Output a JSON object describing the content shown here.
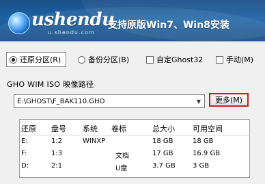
{
  "banner": {
    "logo_text": "ushendu",
    "logo_sub": "u.shendu.com",
    "slogan": "支持原版Win7、Win8安装"
  },
  "options": {
    "restore": "还原分区(R)",
    "backup": "备份分区(B)",
    "custom_ghost": "自定Ghost32",
    "manual": "手动(M)"
  },
  "path": {
    "label": "GHO WIM ISO 映像路径",
    "value": "E:\\GHOST\\F_BAK110.GHO",
    "more_button": "更多(M)"
  },
  "table": {
    "columns": [
      "还原",
      "盘号",
      "系统",
      "卷标",
      "总大小",
      "可用空间"
    ],
    "rows": [
      {
        "restore": "E:",
        "disk": "1:2",
        "system": "WINXP",
        "label": "",
        "total": "18 GB",
        "free": "18 GB"
      },
      {
        "restore": "F:",
        "disk": "1:3",
        "system": "",
        "label": "文档",
        "total": "17 GB",
        "free": "16.9 GB"
      },
      {
        "restore": "D:",
        "disk": "2:1",
        "system": "",
        "label": "U盘",
        "total": "3.7 GB",
        "free": "3 GB"
      }
    ]
  }
}
